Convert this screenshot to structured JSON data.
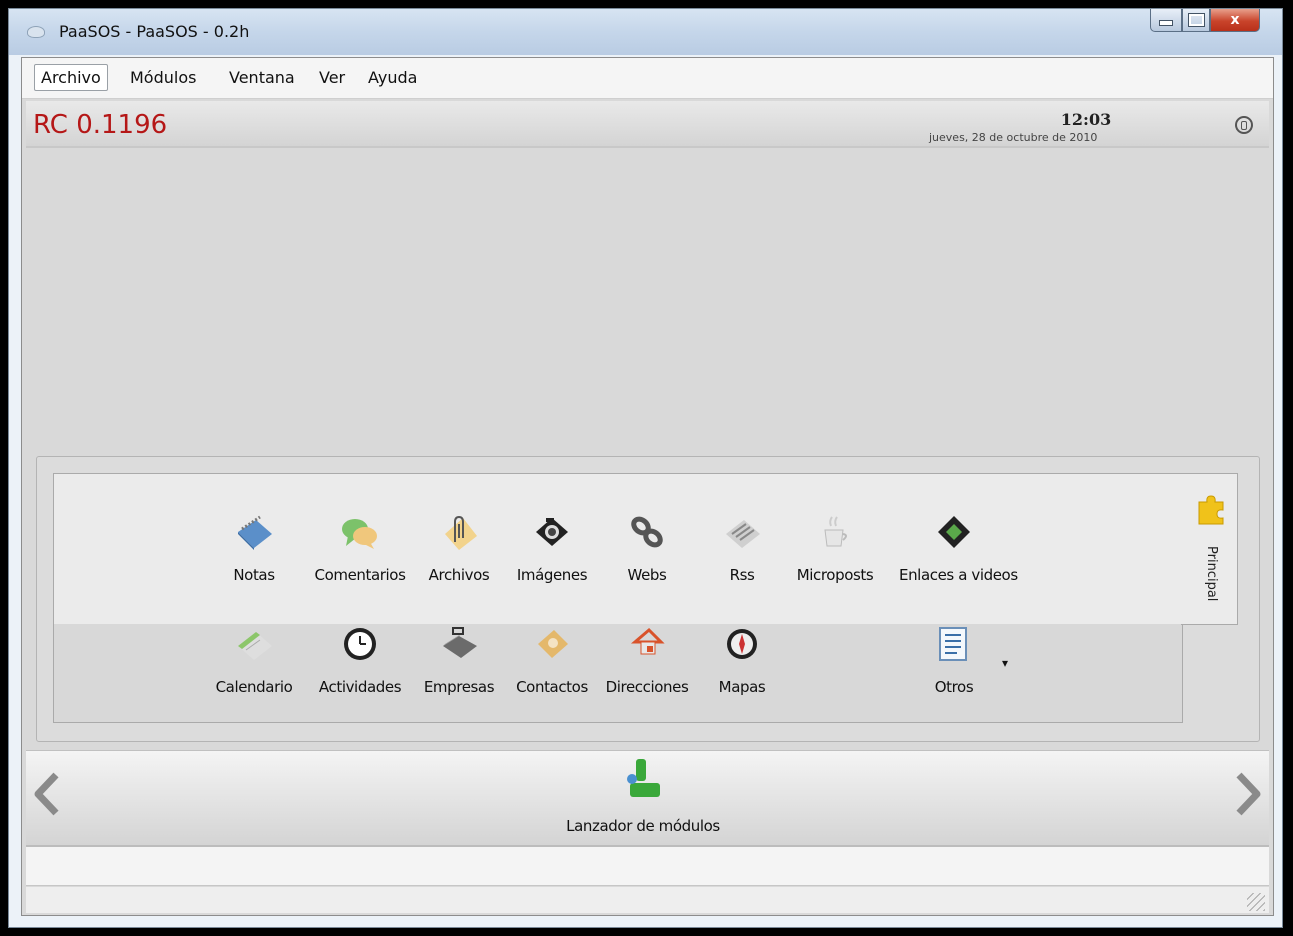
{
  "window": {
    "title": "PaaSOS - PaaSOS - 0.2h",
    "close_glyph": "x"
  },
  "menubar": {
    "items": [
      "Archivo",
      "Módulos",
      "Ventana",
      "Ver",
      "Ayuda"
    ]
  },
  "header": {
    "version": "RC 0.1196",
    "time": "12:03",
    "date": "jueves, 28 de octubre de 2010"
  },
  "modules": {
    "row1": [
      {
        "label": "Notas",
        "icon": "notepad-icon"
      },
      {
        "label": "Comentarios",
        "icon": "speech-bubbles-icon"
      },
      {
        "label": "Archivos",
        "icon": "paperclip-icon"
      },
      {
        "label": "Imágenes",
        "icon": "camera-icon"
      },
      {
        "label": "Webs",
        "icon": "chain-link-icon"
      },
      {
        "label": "Rss",
        "icon": "newspaper-icon"
      },
      {
        "label": "Microposts",
        "icon": "coffee-cup-icon"
      },
      {
        "label": "Enlaces a videos",
        "icon": "film-strip-icon"
      }
    ],
    "row2": [
      {
        "label": "Calendario",
        "icon": "calendar-icon"
      },
      {
        "label": "Actividades",
        "icon": "clock-icon"
      },
      {
        "label": "Empresas",
        "icon": "briefcase-icon"
      },
      {
        "label": "Contactos",
        "icon": "address-book-icon"
      },
      {
        "label": "Direcciones",
        "icon": "house-icon"
      },
      {
        "label": "Mapas",
        "icon": "compass-icon"
      },
      {
        "label": "Otros",
        "icon": "list-document-icon"
      }
    ],
    "dropdown_glyph": "▾",
    "side_tab": "Principal"
  },
  "launcher": {
    "label": "Lanzador de módulos"
  },
  "colors": {
    "accent_red": "#b51717"
  }
}
